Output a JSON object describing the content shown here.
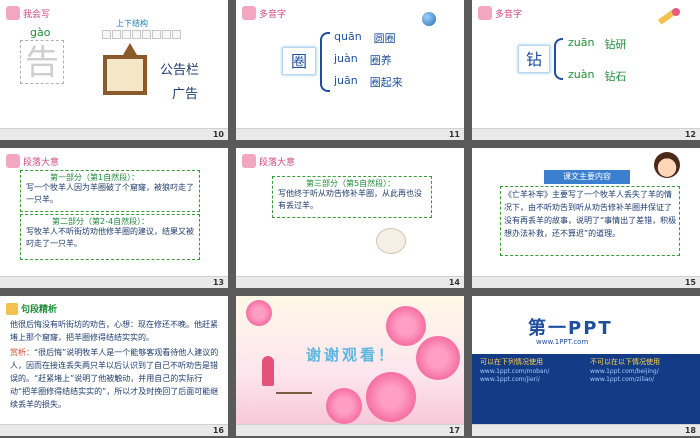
{
  "slides": [
    {
      "id": 1,
      "number": "10",
      "header": "我会写",
      "pinyin": "gào",
      "char": "告",
      "structure": "上下结构",
      "words": [
        "公告栏",
        "广告"
      ]
    },
    {
      "id": 2,
      "number": "11",
      "header": "多音字",
      "char": "圈",
      "rows": [
        {
          "py": "quān",
          "word": "圆圈"
        },
        {
          "py": "juàn",
          "word": "圈养"
        },
        {
          "py": "juān",
          "word": "圈起来"
        }
      ]
    },
    {
      "id": 3,
      "number": "12",
      "header": "多音字",
      "char": "钻",
      "rows": [
        {
          "py": "zuān",
          "word": "钻研"
        },
        {
          "py": "zuàn",
          "word": "钻石"
        }
      ]
    },
    {
      "id": 4,
      "number": "13",
      "header": "段落大意",
      "part1_title": "第一部分（第1自然段）：",
      "part1_text": "写一个牧羊人因为羊圈破了个窟窿，被狼叼走了一只羊。",
      "part2_title": "第二部分（第2-4自然段）：",
      "part2_text": "写牧羊人不听街坊劝他修羊圈的建议，结果又被叼走了一只羊。"
    },
    {
      "id": 5,
      "number": "14",
      "header": "段落大意",
      "title": "第三部分（第5自然段）：",
      "text": "写他终于听从劝告修补羊圈，从此再也没有丢过羊。"
    },
    {
      "id": 6,
      "number": "15",
      "title": "课文主要内容",
      "text": "《亡羊补牢》主要写了一个牧羊人丢失了羊的情况下，由不听劝告到听从劝告修补羊圈并保证了没有再丢羊的故事，说明了“事情出了差错，积极想办法补救，还不算迟”的道理。"
    },
    {
      "id": 7,
      "number": "16",
      "header": "句段精析",
      "sentence": "他很后悔没有听街坊的劝告，心想：现在修还不晚。他赶紧堵上那个窟窿，把羊圈修得结结实实的。",
      "analysis_lead": "赏析：",
      "analysis": "“很后悔”说明牧羊人是一个能够客观看待他人建议的人，因而在接连丢失两只羊以后认识到了自己不听劝告是错误的。“赶紧堵上”说明了他被触动，并用自己的实际行动“把羊圈修得结结实实的”，所以才及时挽回了后面可能继续丢羊的损失。"
    },
    {
      "id": 8,
      "number": "17",
      "thanks": "谢谢观看！"
    },
    {
      "id": 9,
      "number": "18",
      "logo": "第一PPT",
      "url": "www.1PPT.com",
      "left_title": "可以在下列情况使用",
      "right_title": "不可以在以下情况使用",
      "links": [
        "www.1ppt.com/moban/",
        "www.1ppt.com/jieri/",
        "www.1ppt.com/beijing/",
        "www.1ppt.com/ziliao/"
      ]
    }
  ]
}
